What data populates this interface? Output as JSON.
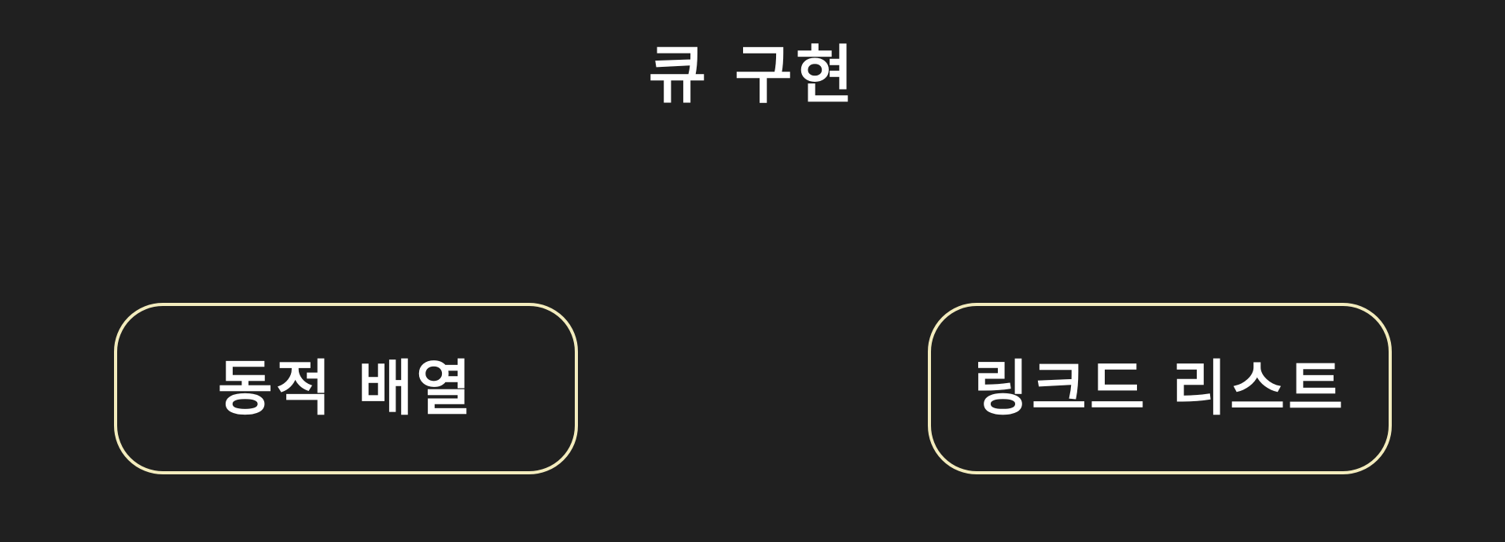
{
  "title": "큐 구현",
  "buttons": {
    "dynamic_array": "동적 배열",
    "linked_list": "링크드 리스트"
  },
  "colors": {
    "background": "#202020",
    "text": "#ffffff",
    "button_border": "#f3ecbd"
  }
}
